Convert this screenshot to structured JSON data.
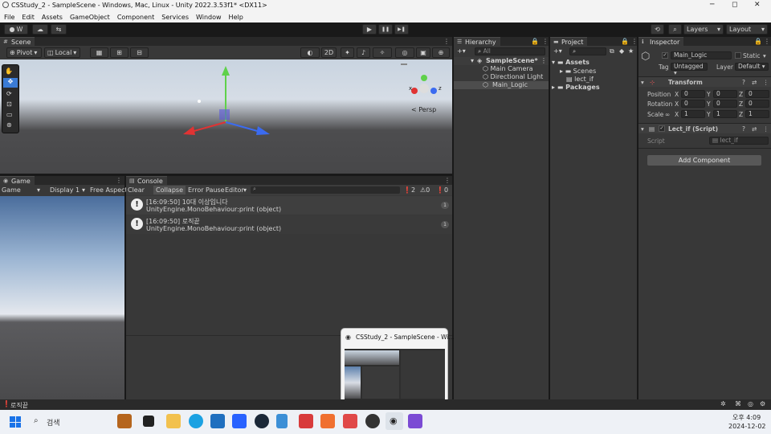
{
  "window": {
    "title": "CSStudy_2 - SampleScene - Windows, Mac, Linux - Unity 2022.3.53f1* <DX11>",
    "min": "─",
    "max": "◻",
    "close": "✕"
  },
  "menu": [
    "File",
    "Edit",
    "Assets",
    "GameObject",
    "Component",
    "Services",
    "Window",
    "Help"
  ],
  "toolbar": {
    "account": "W",
    "layers": "Layers",
    "layout": "Layout",
    "play": "▶",
    "pause": "❚❚",
    "step": "▶❚"
  },
  "scene": {
    "tab": "Scene",
    "pivot": "Pivot",
    "local": "Local",
    "mode2d": "2D",
    "persp": "< Persp",
    "axis_x": "x",
    "axis_z": "z"
  },
  "hierarchy": {
    "tab": "Hierarchy",
    "search": "All",
    "scene": "SampleScene*",
    "items": [
      "Main Camera",
      "Directional Light",
      "Main_Logic"
    ]
  },
  "project": {
    "tab": "Project",
    "assets": "Assets",
    "children": [
      "Scenes",
      "lect_if"
    ],
    "packages": "Packages"
  },
  "inspector": {
    "tab": "Inspector",
    "name": "Main_Logic",
    "static": "Static",
    "tag_label": "Tag",
    "tag": "Untagged",
    "layer_label": "Layer",
    "layer": "Default",
    "transform": "Transform",
    "position": {
      "label": "Position",
      "x": "0",
      "y": "0",
      "z": "0"
    },
    "rotation": {
      "label": "Rotation",
      "x": "0",
      "y": "0",
      "z": "0"
    },
    "scale": {
      "label": "Scale",
      "x": "1",
      "y": "1",
      "z": "1"
    },
    "script_comp": "Lect_if (Script)",
    "script_label": "Script",
    "script_value": "lect_if",
    "add": "Add Component"
  },
  "game": {
    "tab": "Game",
    "mode": "Game",
    "display": "Display 1",
    "aspect": "Free Aspect"
  },
  "console": {
    "tab": "Console",
    "clear": "Clear",
    "collapse": "Collapse",
    "error_pause": "Error Pause",
    "editor": "Editor",
    "counts": {
      "log": "2",
      "warn": "0",
      "err": "0"
    },
    "entries": [
      {
        "line1": "[16:09:50] 10대 이상입니다",
        "line2": "UnityEngine.MonoBehaviour:print (object)",
        "count": "1"
      },
      {
        "line1": "[16:09:50] 로직끝",
        "line2": "UnityEngine.MonoBehaviour:print (object)",
        "count": "1"
      }
    ]
  },
  "status": "로직끝",
  "preview": {
    "title": "CSStudy_2 - SampleScene - Wi..."
  },
  "taskbar": {
    "search": "검색",
    "time": "오후 4:09",
    "date": "2024-12-02"
  },
  "colors": {
    "play_accent": "#4a90d9",
    "x_axis": "#e03333",
    "y_axis": "#5fd14a",
    "z_axis": "#3b6bf0",
    "sky": "#c9d4e0"
  }
}
